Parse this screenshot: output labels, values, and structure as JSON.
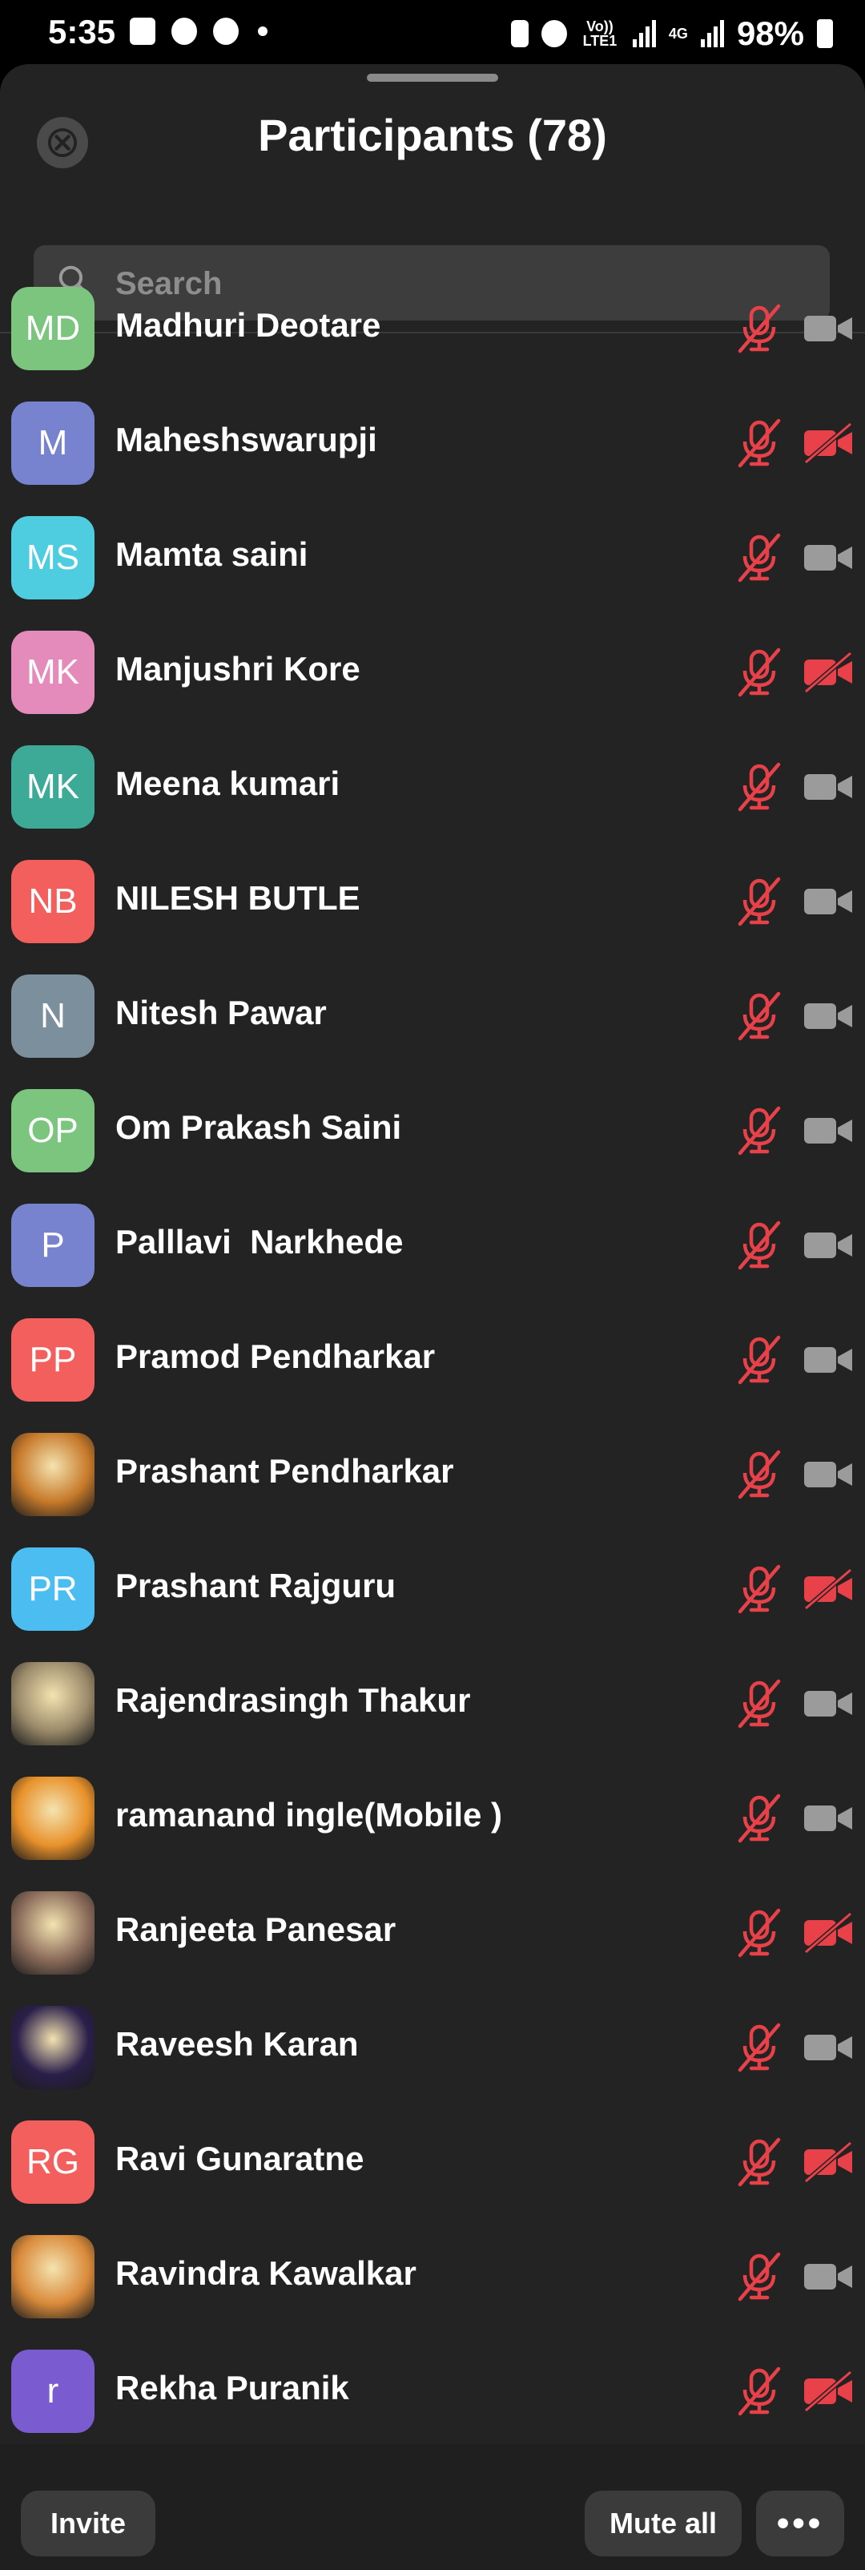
{
  "status_bar": {
    "time": "5:35",
    "network_lte": "Vo)) LTE1",
    "network_4g": "4G",
    "battery": "98%"
  },
  "header": {
    "title": "Participants (78)"
  },
  "search": {
    "placeholder": "Search"
  },
  "colors": {
    "muted_red": "#e8414a",
    "icon_gray": "#9b9b9b",
    "sheet_bg": "#232323"
  },
  "participants": [
    {
      "name": "Madhuri Deotare",
      "initials": "MD",
      "avatar_color": "#7cc57f",
      "avatar_type": "initials",
      "mic": "muted",
      "video": "off-gray"
    },
    {
      "name": "Maheshswarupji",
      "initials": "M",
      "avatar_color": "#7883cf",
      "avatar_type": "initials",
      "mic": "muted",
      "video": "off-red"
    },
    {
      "name": "Mamta saini",
      "initials": "MS",
      "avatar_color": "#4fcde0",
      "avatar_type": "initials",
      "mic": "muted",
      "video": "off-gray"
    },
    {
      "name": "Manjushri Kore",
      "initials": "MK",
      "avatar_color": "#e58bbb",
      "avatar_type": "initials",
      "mic": "muted",
      "video": "off-red"
    },
    {
      "name": "Meena kumari",
      "initials": "MK",
      "avatar_color": "#3daa98",
      "avatar_type": "initials",
      "mic": "muted",
      "video": "off-gray"
    },
    {
      "name": "NILESH BUTLE",
      "initials": "NB",
      "avatar_color": "#f35f5c",
      "avatar_type": "initials",
      "mic": "muted",
      "video": "off-gray"
    },
    {
      "name": "Nitesh Pawar",
      "initials": "N",
      "avatar_color": "#7b8f9c",
      "avatar_type": "initials",
      "mic": "muted",
      "video": "off-gray"
    },
    {
      "name": "Om Prakash Saini",
      "initials": "OP",
      "avatar_color": "#7cc57f",
      "avatar_type": "initials",
      "mic": "muted",
      "video": "off-gray"
    },
    {
      "name": "Palllavi  Narkhede",
      "initials": "P",
      "avatar_color": "#7883cf",
      "avatar_type": "initials",
      "mic": "muted",
      "video": "off-gray"
    },
    {
      "name": "Pramod Pendharkar",
      "initials": "PP",
      "avatar_color": "#f35f5c",
      "avatar_type": "initials",
      "mic": "muted",
      "video": "off-gray"
    },
    {
      "name": "Prashant Pendharkar",
      "initials": "",
      "avatar_color": "#c77a2a",
      "avatar_type": "photo",
      "mic": "muted",
      "video": "off-gray"
    },
    {
      "name": "Prashant Rajguru",
      "initials": "PR",
      "avatar_color": "#4bbdf0",
      "avatar_type": "initials",
      "mic": "muted",
      "video": "off-red"
    },
    {
      "name": "Rajendrasingh Thakur",
      "initials": "",
      "avatar_color": "#9b8a6a",
      "avatar_type": "photo",
      "mic": "muted",
      "video": "off-gray"
    },
    {
      "name": "ramanand ingle(Mobile )",
      "initials": "",
      "avatar_color": "#e8912a",
      "avatar_type": "photo",
      "mic": "muted",
      "video": "off-gray"
    },
    {
      "name": "Ranjeeta Panesar",
      "initials": "",
      "avatar_color": "#8a6b5a",
      "avatar_type": "photo",
      "mic": "muted",
      "video": "off-red"
    },
    {
      "name": "Raveesh Karan",
      "initials": "",
      "avatar_color": "#2a1f4a",
      "avatar_type": "photo",
      "mic": "muted",
      "video": "off-gray"
    },
    {
      "name": "Ravi Gunaratne",
      "initials": "RG",
      "avatar_color": "#f35f5c",
      "avatar_type": "initials",
      "mic": "muted",
      "video": "off-red"
    },
    {
      "name": "Ravindra Kawalkar",
      "initials": "",
      "avatar_color": "#d98a3a",
      "avatar_type": "photo",
      "mic": "muted",
      "video": "off-gray"
    },
    {
      "name": "Rekha Puranik",
      "initials": "r",
      "avatar_color": "#7a5bd0",
      "avatar_type": "initials",
      "mic": "muted",
      "video": "off-red"
    }
  ],
  "footer": {
    "invite_label": "Invite",
    "mute_all_label": "Mute all",
    "more_label": "•••"
  }
}
